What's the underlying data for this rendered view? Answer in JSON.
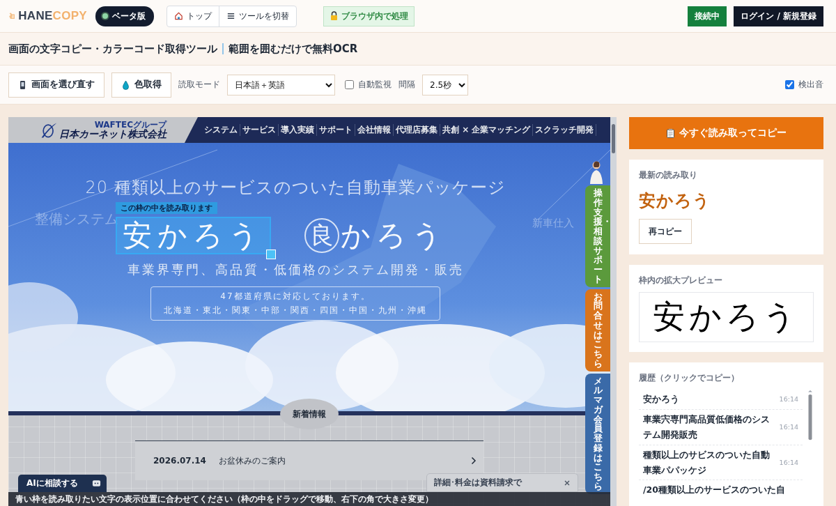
{
  "header": {
    "logo": [
      "HANE",
      "COPY"
    ],
    "beta_badge": "ベータ版",
    "nav": [
      "トップ",
      "ツールを切替"
    ],
    "privacy_badge": "ブラウザ内で処理",
    "status": "接続中",
    "login": "ログイン / 新規登録"
  },
  "page_title": {
    "main": "画面の文字コピー・カラーコード取得ツール",
    "sub": "範囲を囲むだけで無料OCR"
  },
  "toolbar": {
    "reselect": "画面を選び直す",
    "pick_color": "色取得",
    "mode_label": "読取モード",
    "mode_value": "日本語＋英語",
    "auto_watch": {
      "label": "自動監視",
      "checked": false
    },
    "interval_label": "間隔",
    "interval_value": "2.5秒",
    "sound": {
      "label": "検出音",
      "checked": true
    }
  },
  "capture": {
    "company_group": "WAFTECグループ",
    "company": "日本カーネット株式会社",
    "nav": [
      "システム",
      "サービス",
      "導入実績",
      "サポート",
      "会社情報",
      "代理店募集",
      "共創 × 企業マッチング",
      "スクラッチ開発"
    ],
    "bg_words": [
      "整備システム",
      "新車仕入"
    ],
    "headline": "20 種類以上のサービスのついた自動車業パッケージ",
    "frame_label": "この枠の中を読み取ります",
    "catch_selected": "安かろう",
    "catch_mark": "良",
    "catch_rest": "かろう",
    "tagline": "車業界専門、高品質・低価格のシステム開発・販売",
    "area": {
      "title": "47都道府県に対応しております。",
      "regions": "北海道・東北・関東・中部・関西・四国・中国・九州・沖縄"
    },
    "news": {
      "heading": "新着情報",
      "items": [
        {
          "date": "2026.07.14",
          "title": "お盆休みのご案内"
        }
      ]
    },
    "side_tabs": [
      {
        "label": "操作支援・相談サポート",
        "color": "#5b9a3c"
      },
      {
        "label": "お問合せはこちら",
        "color": "#d9741c"
      },
      {
        "label": "メルマガ会員登録はこちら",
        "color": "#3a6aa8"
      }
    ],
    "ai_chat": "AIに相談する",
    "promo": "詳細･料金は資料請求で",
    "hint": "青い枠を読み取りたい文字の表示位置に合わせてください（枠の中をドラッグで移動、右下の角で大きさ変更）"
  },
  "sidebar": {
    "copy_button": "今すぐ読み取ってコピー",
    "latest": {
      "heading": "最新の読み取り",
      "text": "安かろう",
      "recopy": "再コピー"
    },
    "preview": {
      "heading": "枠内の拡大プレビュー",
      "text": "安かろう"
    },
    "history": {
      "heading": "履歴（クリックでコピー）",
      "items": [
        {
          "text": "安かろう",
          "time": "16:14"
        },
        {
          "text": "車業宍専門高品質低価格のシステム開発販売",
          "time": "16:14"
        },
        {
          "text": "種類以上のサビスのついた自動車業パパッケジ",
          "time": "16:14"
        },
        {
          "text": "/20種類以上のサービスのついた自"
        }
      ]
    }
  }
}
